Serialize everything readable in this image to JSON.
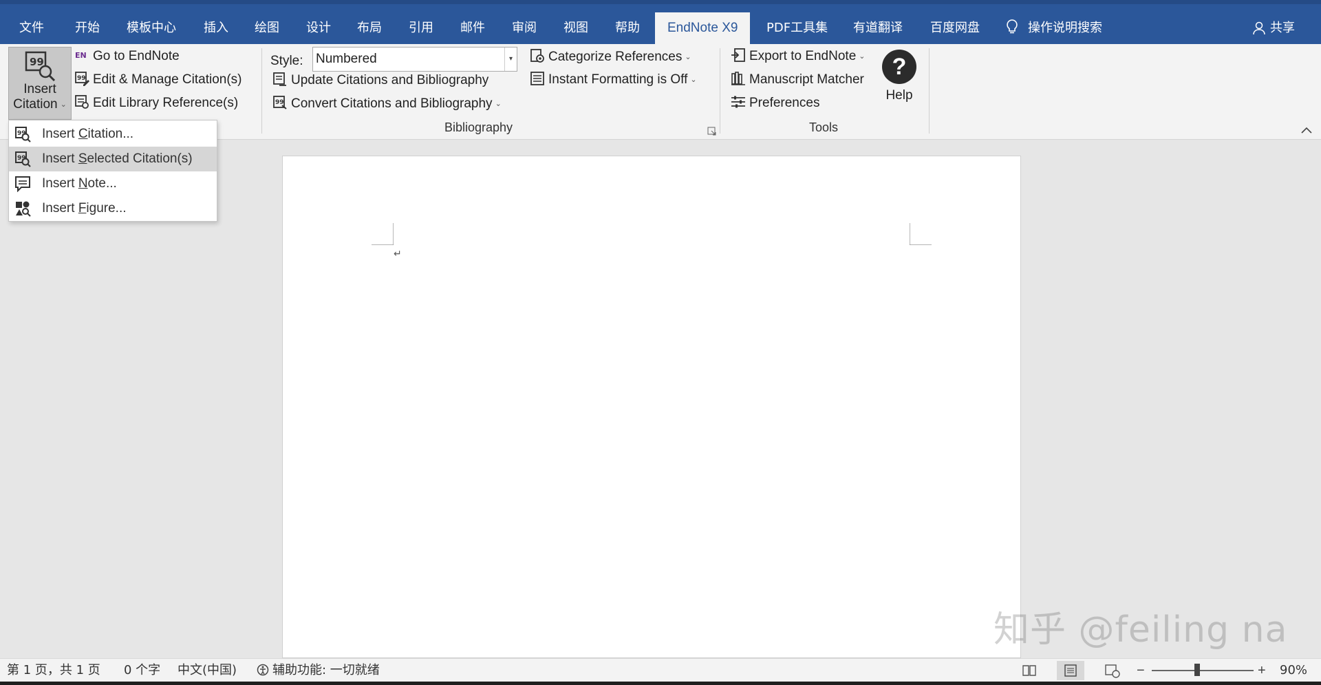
{
  "tabs": {
    "file": "文件",
    "home": "开始",
    "templates": "模板中心",
    "insert": "插入",
    "draw": "绘图",
    "design": "设计",
    "layout": "布局",
    "references": "引用",
    "mailings": "邮件",
    "review": "审阅",
    "view": "视图",
    "help": "帮助",
    "endnote": "EndNote X9",
    "pdf_tools": "PDF工具集",
    "youdao": "有道翻译",
    "baidu": "百度网盘",
    "tell_me": "操作说明搜索",
    "share": "共享"
  },
  "ribbon": {
    "citations": {
      "insert_citation_line1": "Insert",
      "insert_citation_line2": "Citation",
      "go_to_endnote": "Go to EndNote",
      "edit_manage": "Edit & Manage Citation(s)",
      "edit_library": "Edit Library Reference(s)"
    },
    "bibliography": {
      "style_label": "Style:",
      "style_value": "Numbered",
      "update": "Update Citations and Bibliography",
      "convert": "Convert Citations and Bibliography",
      "categorize": "Categorize References",
      "instant_formatting": "Instant Formatting is Off",
      "group_label": "Bibliography"
    },
    "tools": {
      "export": "Export to EndNote",
      "manuscript": "Manuscript Matcher",
      "preferences": "Preferences",
      "help": "Help",
      "group_label": "Tools"
    }
  },
  "dropdown": {
    "items": [
      {
        "pre": "Insert ",
        "key": "C",
        "post": "itation..."
      },
      {
        "pre": "Insert ",
        "key": "S",
        "post": "elected Citation(s)"
      },
      {
        "pre": "Insert ",
        "key": "N",
        "post": "ote..."
      },
      {
        "pre": "Insert ",
        "key": "F",
        "post": "igure..."
      }
    ],
    "selected_index": 1
  },
  "document": {
    "paragraph_mark": "↵"
  },
  "watermark": "知乎 @feiling na",
  "status": {
    "page": "第 1 页，共 1 页",
    "words": "0 个字",
    "language": "中文(中国)",
    "accessibility": "辅助功能: 一切就绪",
    "zoom_minus": "−",
    "zoom_plus": "+",
    "zoom": "90%",
    "zoom_percent": 90
  },
  "colors": {
    "brand": "#2b579a",
    "ribbon_bg": "#f3f3f3",
    "menu_selected": "#d6d6d6"
  },
  "icons": [
    "insert-citation-icon",
    "endnote-en-icon",
    "edit-citation-icon",
    "edit-library-icon",
    "update-icon",
    "convert-icon",
    "categorize-icon",
    "instant-format-icon",
    "export-icon",
    "manuscript-icon",
    "preferences-icon",
    "help-icon",
    "lightbulb-icon",
    "user-icon",
    "insert-note-icon",
    "insert-figure-icon"
  ]
}
